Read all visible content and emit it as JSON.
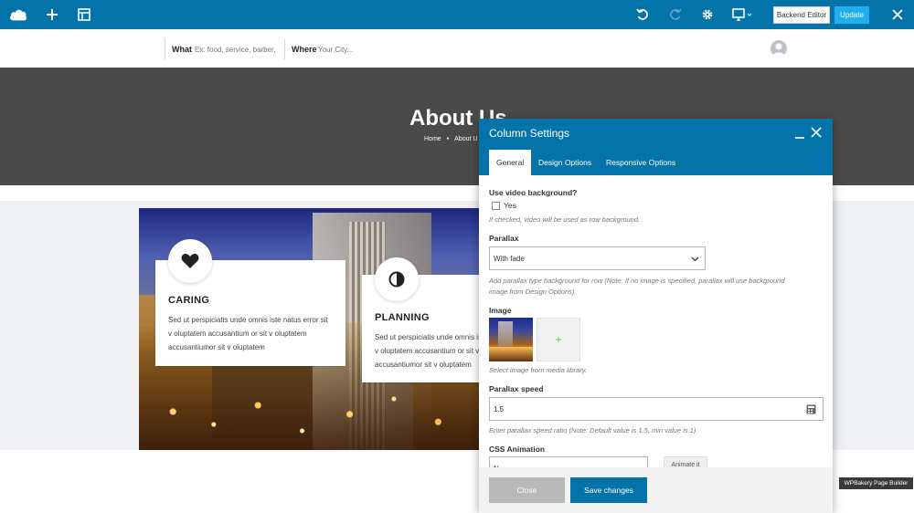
{
  "toolbar": {
    "icons": [
      "cloud-logo-icon",
      "plus-icon",
      "layout-icon",
      "undo-icon",
      "redo-icon",
      "gear-icon",
      "monitor-icon",
      "close-icon"
    ],
    "backend_editor_label": "Backend Editor",
    "update_label": "Update"
  },
  "search": {
    "what_label": "What",
    "what_placeholder": "Ex: food, service, barber,",
    "where_label": "Where",
    "where_placeholder": "Your City..."
  },
  "hero": {
    "title": "About Us",
    "breadcrumbs": [
      "Home",
      "About U"
    ]
  },
  "cards": [
    {
      "icon": "heart-icon",
      "title": "CARING",
      "text": "Sed ut perspiciatis unde omnis iste natus error sit v oluptatem accusantium or sit v oluptatem accusantiumor sit v oluptatem"
    },
    {
      "icon": "contrast-icon",
      "title": "PLANNING",
      "text": "Sed ut perspiciatis unde omnis iste natus error sit v oluptatem accusantium or sit v oluptatem accusantiumor sit v oluptatem"
    }
  ],
  "modal": {
    "title": "Column Settings",
    "tabs": [
      "General",
      "Design Options",
      "Responsive Options"
    ],
    "active_tab": "General",
    "video_bg": {
      "label": "Use video background?",
      "option": "Yes",
      "checked": false,
      "help": "If checked, video will be used as row background."
    },
    "parallax": {
      "label": "Parallax",
      "value": "With fade",
      "help_line1": "Add parallax type background for row (Note: If no image is specified, parallax will use background",
      "help_line2": "image from Design Options)."
    },
    "image": {
      "label": "Image",
      "help": "Select image from media library.",
      "add_symbol": "+"
    },
    "parallax_speed": {
      "label": "Parallax speed",
      "value": "1.5",
      "help": "Enter parallax speed ratio (Note: Default value is 1.5, min value is 1)"
    },
    "css_animation": {
      "label": "CSS Animation",
      "value": "N",
      "animate_button": "Animate it"
    },
    "close_label": "Close",
    "save_label": "Save changes"
  },
  "badge": "WPBakery Page Builder",
  "colors": {
    "brand_blue": "#0473aa",
    "update_blue": "#1fb0f0",
    "hero_gray": "#4a4a4a",
    "add_green": "#6cc04a"
  }
}
